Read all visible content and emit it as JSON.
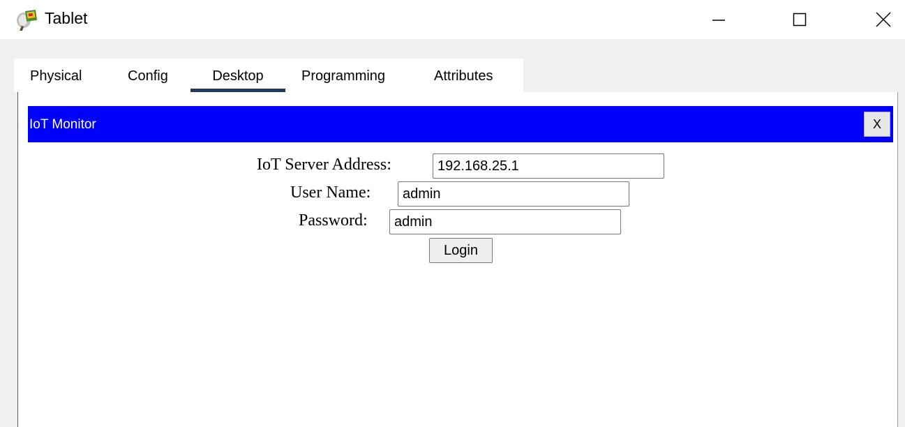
{
  "window": {
    "title": "Tablet",
    "icon": "tablet-app-icon",
    "controls": {
      "minimize": "minimize-icon",
      "maximize": "maximize-icon",
      "close": "close-icon"
    }
  },
  "tabs": [
    {
      "label": "Physical",
      "active": false
    },
    {
      "label": "Config",
      "active": false
    },
    {
      "label": "Desktop",
      "active": true
    },
    {
      "label": "Programming",
      "active": false
    },
    {
      "label": "Attributes",
      "active": false
    }
  ],
  "app": {
    "title": "IoT Monitor",
    "close_label": "X",
    "header_color": "#0000ff"
  },
  "form": {
    "server_label": "IoT Server Address:",
    "server_value": "192.168.25.1",
    "username_label": "User Name:",
    "username_value": "admin",
    "password_label": "Password:",
    "password_value": "admin",
    "login_label": "Login"
  }
}
